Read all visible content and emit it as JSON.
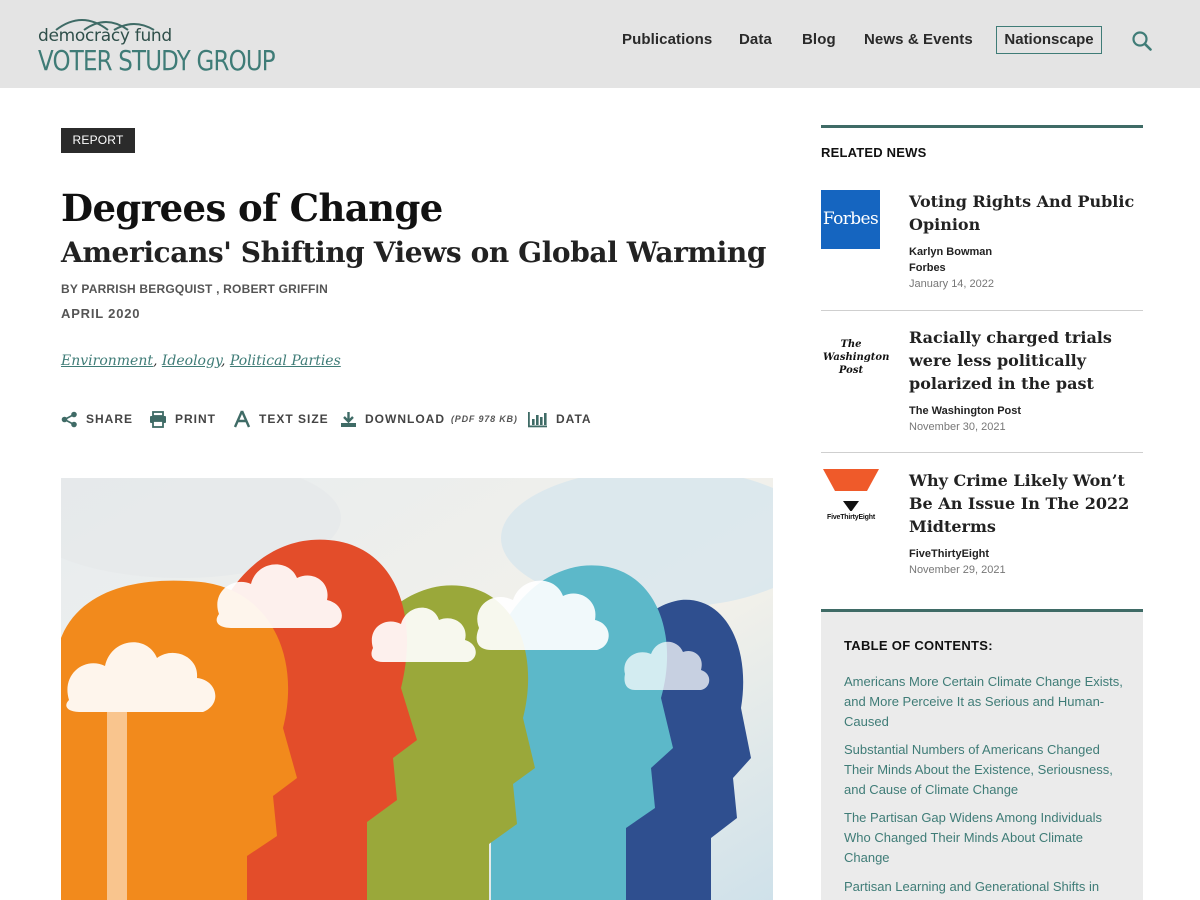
{
  "brand": {
    "line1": "democracy fund",
    "line2": "VOTER STUDY GROUP",
    "color": "#3f7c77"
  },
  "nav": {
    "items": [
      "Publications",
      "Data",
      "Blog",
      "News & Events"
    ],
    "highlight": "Nationscape",
    "search_icon": "search-icon"
  },
  "article": {
    "badge": "REPORT",
    "title": "Degrees of Change",
    "subtitle": "Americans' Shifting Views on Global Warming",
    "byline": "BY PARRISH BERGQUIST , ROBERT GRIFFIN",
    "date": "APRIL 2020",
    "tags": [
      "Environment",
      "Ideology",
      "Political Parties"
    ],
    "tag_separator": ","
  },
  "toolbar": {
    "share": "SHARE",
    "print": "PRINT",
    "text_size": "TEXT SIZE",
    "download": "DOWNLOAD",
    "download_info": "(PDF 978 KB)",
    "data": "DATA"
  },
  "related": {
    "heading": "RELATED NEWS",
    "items": [
      {
        "logo": "Forbes",
        "title": "Voting Rights And Public Opinion",
        "author": "Karlyn Bowman",
        "source": "Forbes",
        "date": "January 14, 2022"
      },
      {
        "logo": "The Washington Post",
        "title": "Racially charged trials were less politically polarized in the past",
        "author": "",
        "source": "The Washington Post",
        "date": "November 30, 2021"
      },
      {
        "logo": "FiveThirtyEight",
        "title": "Why Crime Likely Won’t Be An Issue In The 2022 Midterms",
        "author": "",
        "source": "FiveThirtyEight",
        "date": "November 29, 2021"
      }
    ]
  },
  "toc": {
    "heading": "TABLE OF CONTENTS:",
    "items": [
      "Americans More Certain Climate Change Exists, and More Perceive It as Serious and Human-Caused",
      "Substantial Numbers of Americans Changed Their Minds About the Existence, Seriousness, and Cause of Climate Change",
      "The Partisan Gap Widens Among Individuals Who Changed Their Minds About Climate Change",
      "Partisan Learning and Generational Shifts in"
    ]
  },
  "colors": {
    "accent": "#3f7c77",
    "header_bg": "#e4e4e4",
    "badge_bg": "#2b2b2b",
    "forbes_blue": "#1565c0",
    "fte_orange": "#ef5a2a"
  }
}
